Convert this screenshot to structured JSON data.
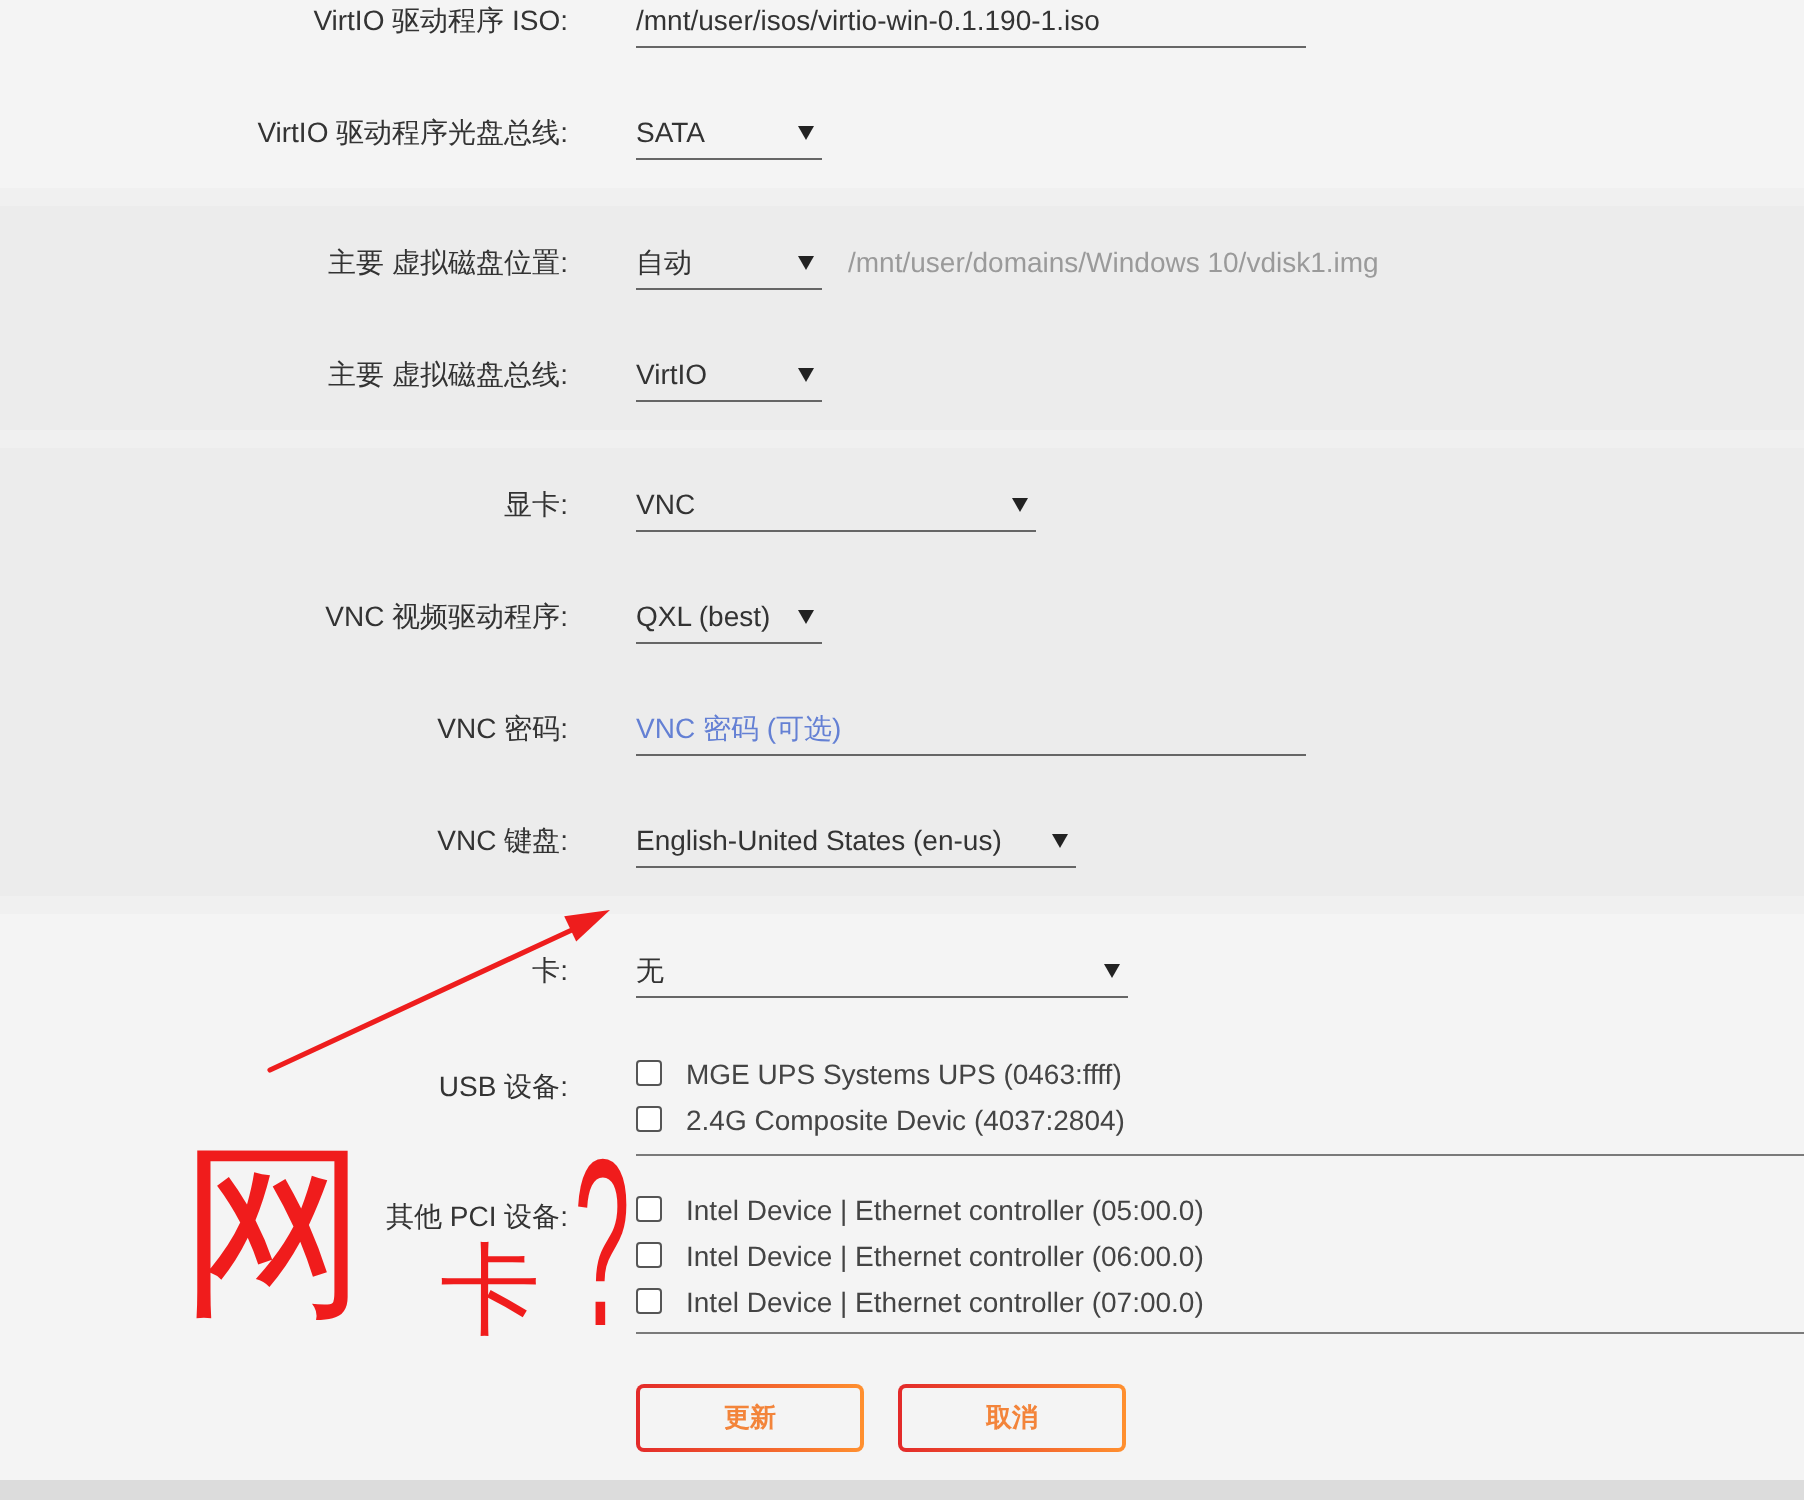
{
  "sections": [
    {
      "rows": [
        {
          "kind": "text",
          "label": "VirtIO 驱动程序 ISO:",
          "value": "/mnt/user/isos/virtio-win-0.1.190-1.iso"
        },
        {
          "kind": "select",
          "label": "VirtIO 驱动程序光盘总线:",
          "value": "SATA"
        }
      ]
    },
    {
      "rows": [
        {
          "kind": "select",
          "label": "主要 虚拟磁盘位置:",
          "value": "自动",
          "note": "/mnt/user/domains/Windows 10/vdisk1.img"
        },
        {
          "kind": "select",
          "label": "主要 虚拟磁盘总线:",
          "value": "VirtIO"
        }
      ]
    },
    {
      "rows": [
        {
          "kind": "select",
          "label": "显卡:",
          "value": "VNC"
        },
        {
          "kind": "select",
          "label": "VNC 视频驱动程序:",
          "value": "QXL (best)"
        },
        {
          "kind": "text",
          "label": "VNC 密码:",
          "placeholder": "VNC 密码 (可选)"
        },
        {
          "kind": "select",
          "label": "VNC 键盘:",
          "value": "English-United States (en-us)"
        }
      ]
    },
    {
      "rows": [
        {
          "kind": "select",
          "label": "卡:",
          "value": "无"
        },
        {
          "kind": "checklist",
          "label": "USB 设备:",
          "items": [
            {
              "label": "MGE UPS Systems UPS (0463:ffff)",
              "checked": false
            },
            {
              "label": "2.4G Composite Devic (4037:2804)",
              "checked": false
            }
          ]
        },
        {
          "kind": "checklist",
          "label": "其他 PCI 设备:",
          "items": [
            {
              "label": "Intel Device | Ethernet controller (05:00.0)",
              "checked": false
            },
            {
              "label": "Intel Device | Ethernet controller (06:00.0)",
              "checked": false
            },
            {
              "label": "Intel Device | Ethernet controller (07:00.0)",
              "checked": false
            }
          ]
        }
      ],
      "buttons": [
        "更新",
        "取消"
      ]
    }
  ],
  "annotations": [
    {
      "kind": "arrow"
    },
    {
      "kind": "handwriting",
      "text": "网"
    },
    {
      "kind": "handwriting",
      "text": "卡"
    },
    {
      "kind": "handwriting",
      "text": "?"
    }
  ]
}
